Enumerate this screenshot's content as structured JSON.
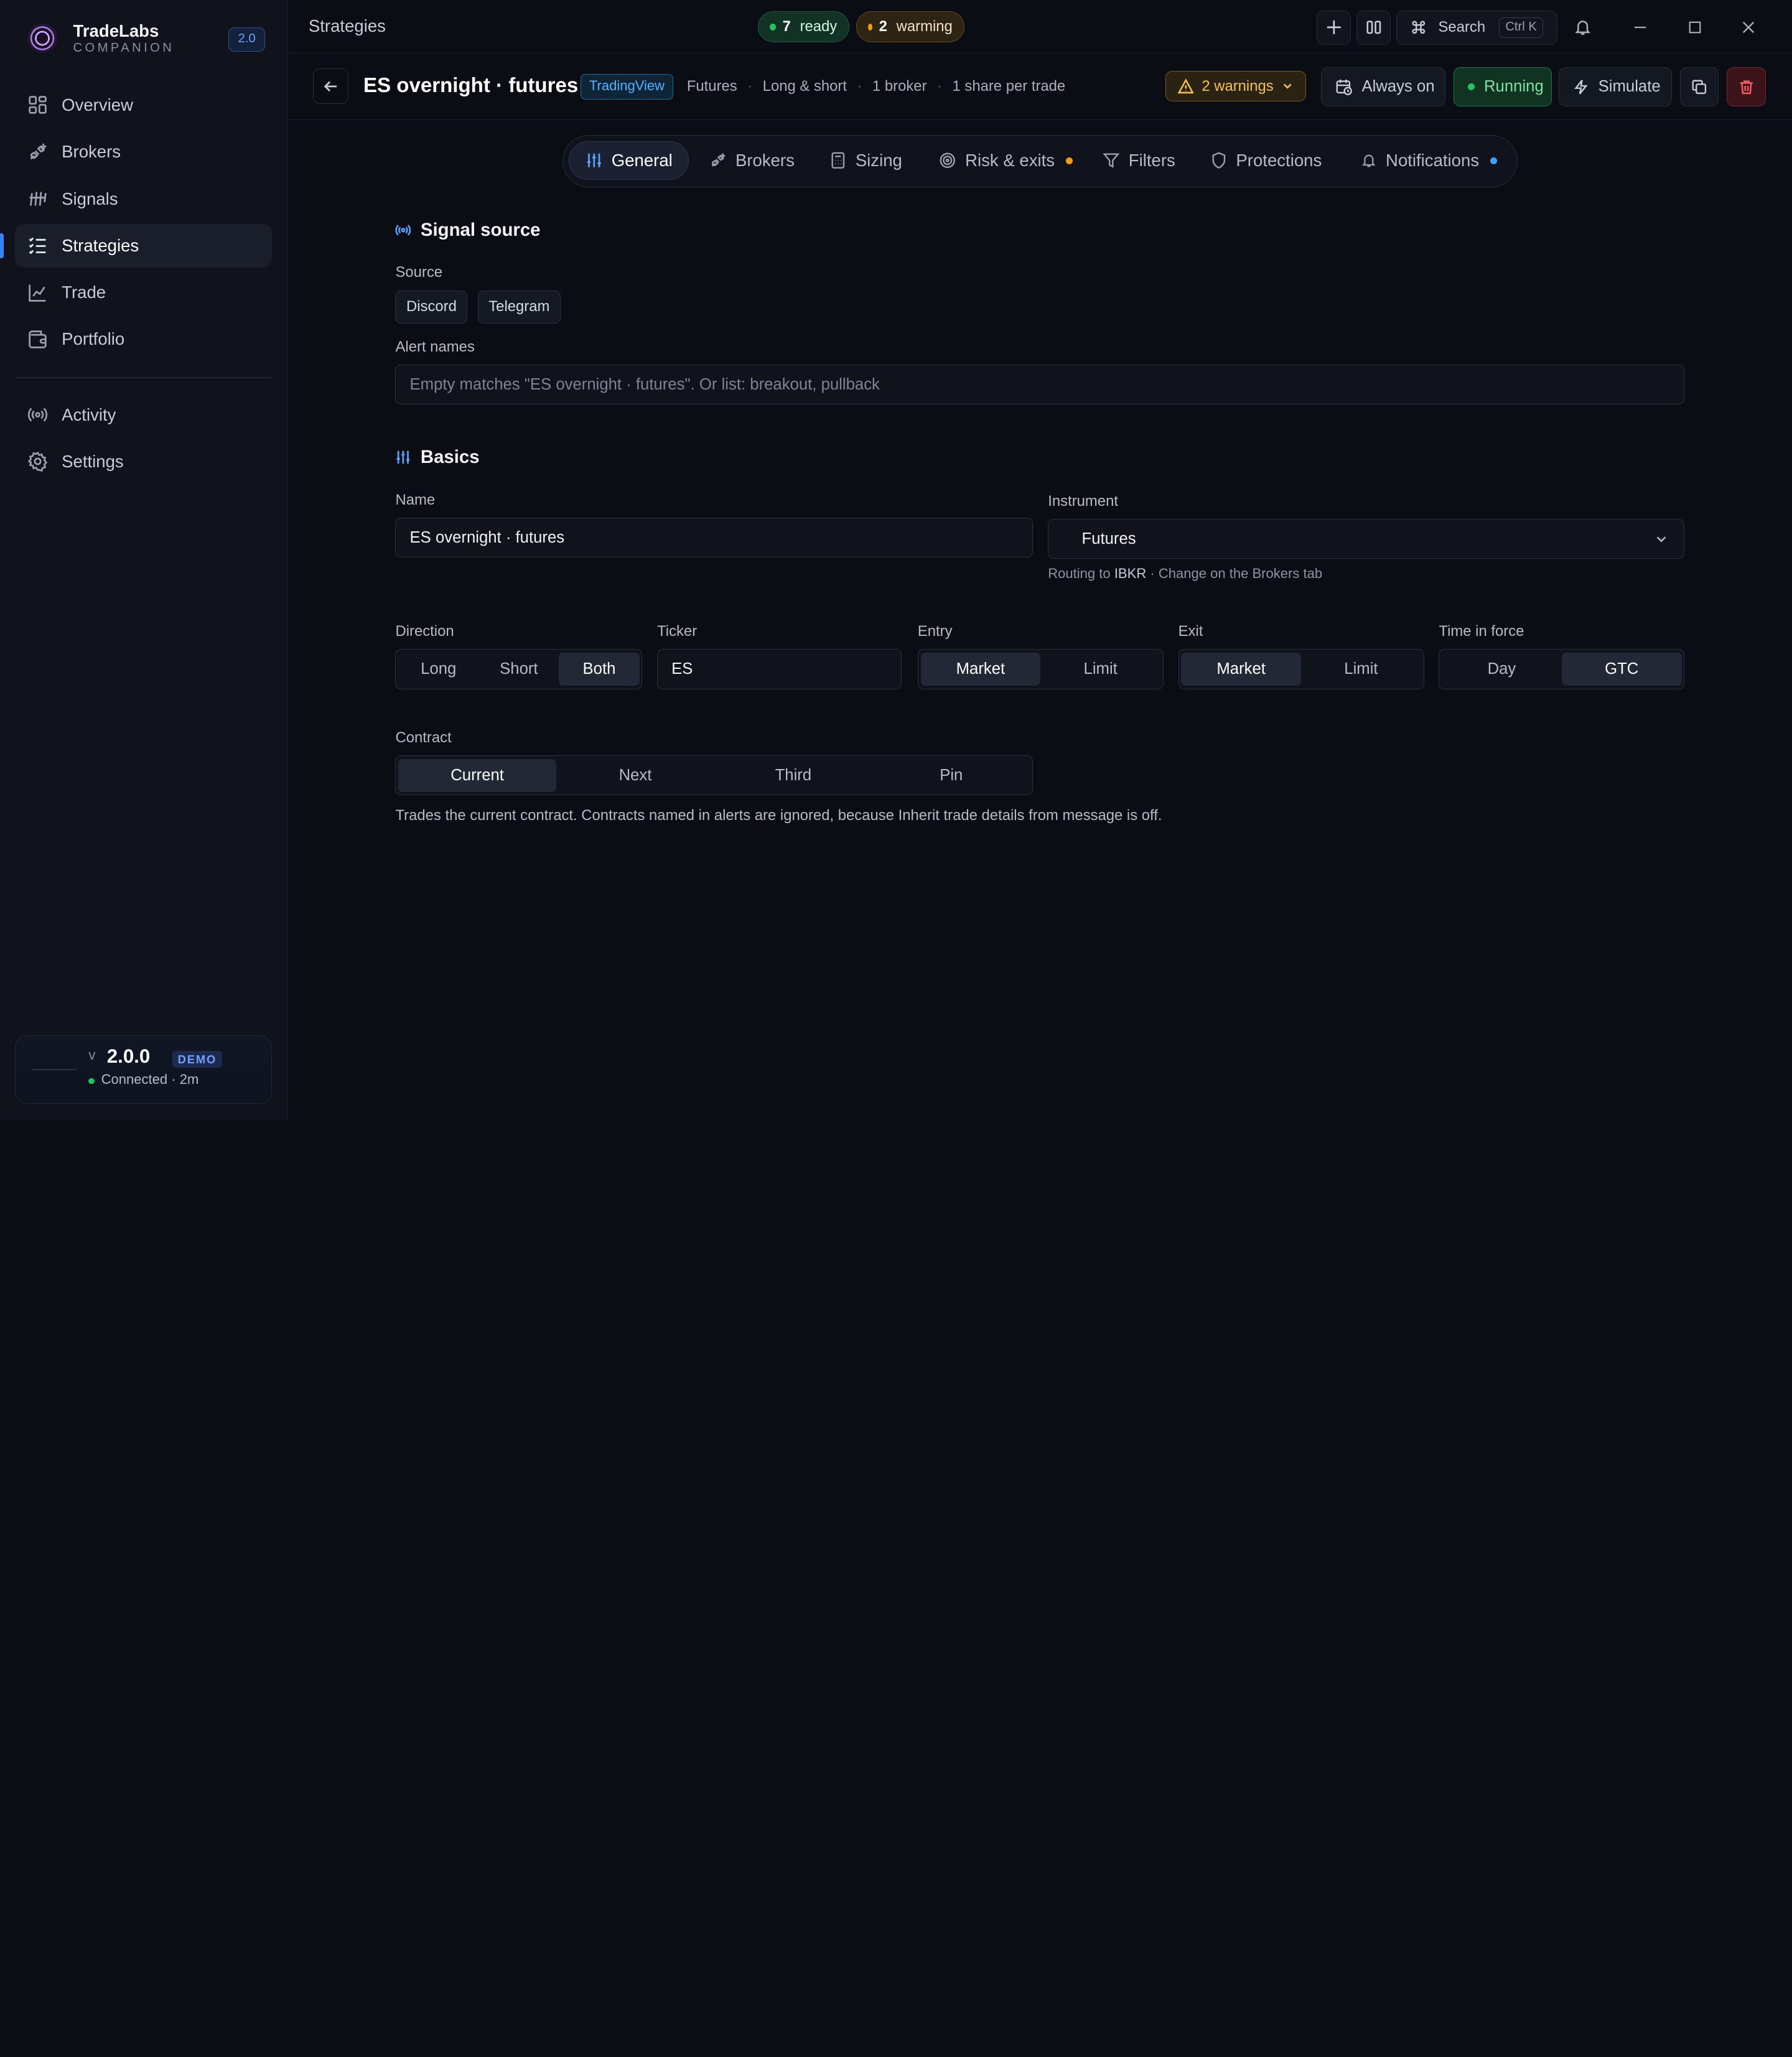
{
  "colors": {
    "accent": "#3b82f6",
    "ready": "#22c55e",
    "warning": "#f59e0b",
    "danger": "#f25a64",
    "notif": "#3ba3ff"
  },
  "brand": {
    "name": "TradeLabs",
    "sub": "COMPANION",
    "version_badge": "2.0"
  },
  "sidebar": {
    "items": [
      {
        "label": "Overview",
        "icon": "grid-icon"
      },
      {
        "label": "Brokers",
        "icon": "plug-icon"
      },
      {
        "label": "Signals",
        "icon": "signal-lines-icon"
      },
      {
        "label": "Strategies",
        "icon": "list-icon",
        "active": true
      },
      {
        "label": "Trade",
        "icon": "chart-line-icon"
      },
      {
        "label": "Portfolio",
        "icon": "wallet-icon"
      }
    ],
    "items2": [
      {
        "label": "Activity",
        "icon": "broadcast-icon"
      },
      {
        "label": "Settings",
        "icon": "gear-icon"
      }
    ],
    "status": {
      "v_prefix": "v",
      "version": "2.0.0",
      "demo": "DEMO",
      "connection": "Connected · 2m"
    }
  },
  "topbar": {
    "title": "Strategies",
    "ready": {
      "count": "7",
      "label": "ready"
    },
    "warming": {
      "count": "2",
      "label": "warming"
    },
    "search_label": "Search",
    "search_kbd": "Ctrl K"
  },
  "header": {
    "title": "ES overnight · futures",
    "source_badge": "TradingView",
    "meta": [
      "Futures",
      "Long & short",
      "1 broker",
      "1 share per trade"
    ],
    "warnings": "2 warnings",
    "schedule": "Always on",
    "status": "Running",
    "simulate": "Simulate"
  },
  "tabs": [
    {
      "label": "General",
      "icon": "sliders-icon",
      "active": true
    },
    {
      "label": "Brokers",
      "icon": "plug-icon"
    },
    {
      "label": "Sizing",
      "icon": "calculator-icon"
    },
    {
      "label": "Risk & exits",
      "icon": "target-icon",
      "dot": "#f59e0b"
    },
    {
      "label": "Filters",
      "icon": "filter-icon"
    },
    {
      "label": "Protections",
      "icon": "shield-icon"
    },
    {
      "label": "Notifications",
      "icon": "bell-icon",
      "dot": "#3ba3ff"
    }
  ],
  "signal_source": {
    "title": "Signal source",
    "source_label": "Source",
    "sources": [
      "Discord",
      "Telegram"
    ],
    "alert_label": "Alert names",
    "alert_placeholder": "Empty matches \"ES overnight · futures\". Or list: breakout, pullback"
  },
  "basics": {
    "title": "Basics",
    "name_label": "Name",
    "name_value": "ES overnight · futures",
    "instrument_label": "Instrument",
    "instrument_value": "Futures",
    "routing_prefix": "Routing to",
    "routing_broker": "IBKR",
    "routing_suffix": "· Change on the Brokers tab",
    "direction": {
      "label": "Direction",
      "options": [
        "Long",
        "Short",
        "Both"
      ],
      "selected": "Both"
    },
    "ticker": {
      "label": "Ticker",
      "value": "ES"
    },
    "entry": {
      "label": "Entry",
      "options": [
        "Market",
        "Limit"
      ],
      "selected": "Market"
    },
    "exit": {
      "label": "Exit",
      "options": [
        "Market",
        "Limit"
      ],
      "selected": "Market"
    },
    "tif": {
      "label": "Time in force",
      "options": [
        "Day",
        "GTC"
      ],
      "selected": "GTC"
    },
    "contract": {
      "label": "Contract",
      "options": [
        "Current",
        "Next",
        "Third",
        "Pin"
      ],
      "selected": "Current"
    },
    "contract_note": "Trades the current contract. Contracts named in alerts are ignored, because Inherit trade details from message is off."
  }
}
